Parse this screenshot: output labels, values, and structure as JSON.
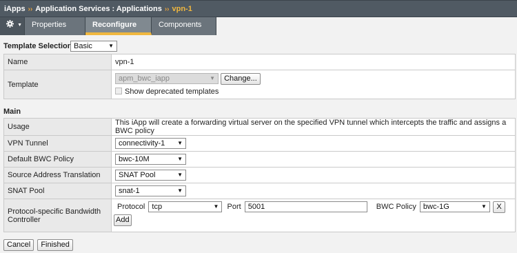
{
  "breadcrumb": {
    "root": "iApps",
    "section": "Application Services : Applications",
    "current": "vpn-1",
    "separator": "››"
  },
  "tabs": {
    "gear_icon": "gear-icon",
    "properties": "Properties",
    "reconfigure": "Reconfigure",
    "components": "Components"
  },
  "template_selection": {
    "label": "Template Selection:",
    "value": "Basic"
  },
  "top_table": {
    "name_label": "Name",
    "name_value": "vpn-1",
    "template_label": "Template",
    "template_value": "apm_bwc_iapp",
    "change_button": "Change...",
    "deprecated_label": "Show deprecated templates"
  },
  "main": {
    "title": "Main",
    "usage_label": "Usage",
    "usage_text": "This iApp will create a forwarding virtual server on the specified VPN tunnel which intercepts the traffic and assigns a BWC policy",
    "vpn_tunnel_label": "VPN Tunnel",
    "vpn_tunnel_value": "connectivity-1",
    "bwc_policy_label": "Default BWC Policy",
    "bwc_policy_value": "bwc-10M",
    "sat_label": "Source Address Translation",
    "sat_value": "SNAT Pool",
    "snat_pool_label": "SNAT Pool",
    "snat_pool_value": "snat-1",
    "pbc_label": "Protocol-specific Bandwidth Controller",
    "protocol_label": "Protocol",
    "protocol_value": "tcp",
    "port_label": "Port",
    "port_value": "5001",
    "row_bwc_label": "BWC Policy",
    "row_bwc_value": "bwc-1G",
    "remove_button": "X",
    "add_button": "Add"
  },
  "footer": {
    "cancel": "Cancel",
    "finished": "Finished"
  }
}
